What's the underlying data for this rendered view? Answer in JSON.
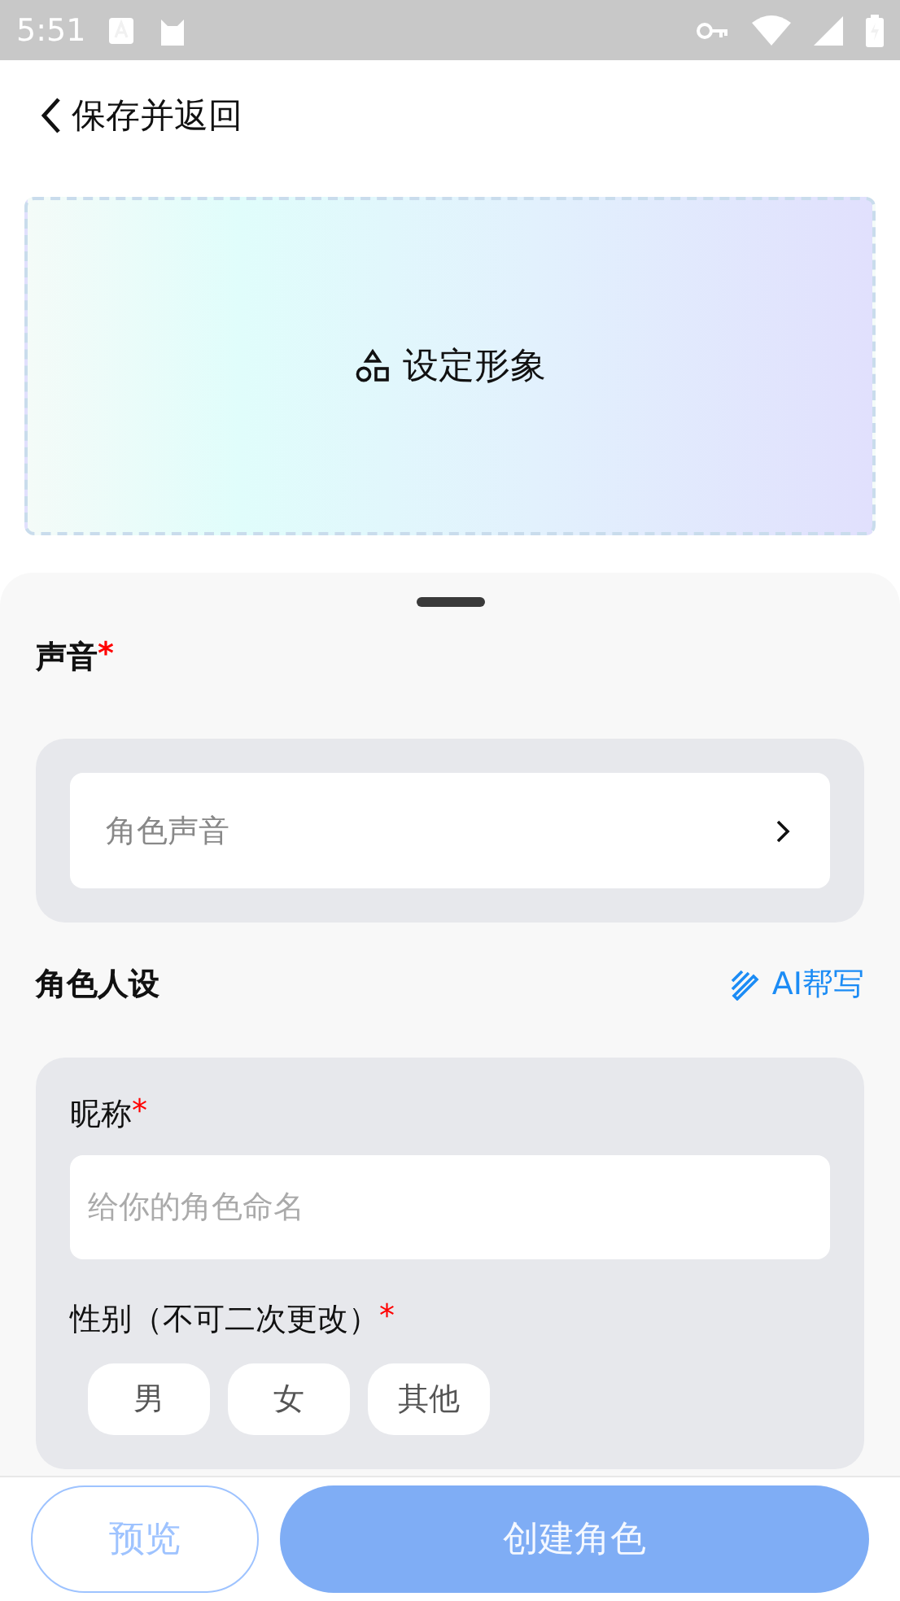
{
  "status_bar": {
    "time": "5:51"
  },
  "header": {
    "back_label": "保存并返回"
  },
  "avatar_area": {
    "label": "设定形象"
  },
  "voice": {
    "title": "声音",
    "required_mark": "*",
    "placeholder": "角色声音"
  },
  "persona": {
    "title": "角色人设",
    "ai_button": "AI帮写",
    "nickname": {
      "label": "昵称",
      "required_mark": "*",
      "placeholder": "给你的角色命名"
    },
    "gender": {
      "label": "性别（不可二次更改）",
      "required_mark": "*",
      "options": [
        {
          "label": "男",
          "selected": false
        },
        {
          "label": "女",
          "selected": false
        },
        {
          "label": "其他",
          "selected": false
        }
      ]
    }
  },
  "footer": {
    "preview": "预览",
    "create": {
      "label": "创建角色",
      "disabled": true
    }
  }
}
